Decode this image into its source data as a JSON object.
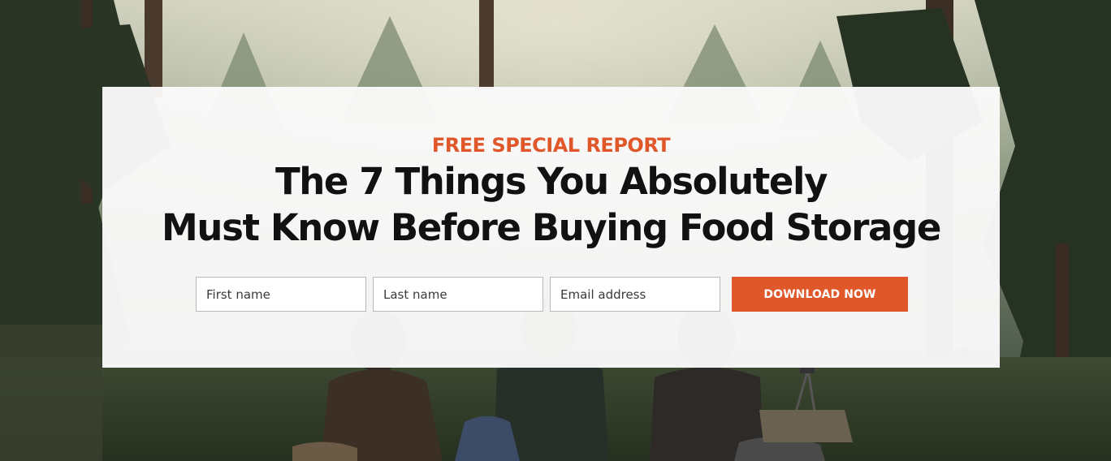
{
  "hero": {
    "eyebrow": "FREE SPECIAL REPORT",
    "headline_line1": "The 7 Things You Absolutely",
    "headline_line2": "Must Know Before Buying Food Storage"
  },
  "form": {
    "first_name_placeholder": "First name",
    "last_name_placeholder": "Last name",
    "email_placeholder": "Email address",
    "submit_label": "DOWNLOAD NOW"
  },
  "colors": {
    "accent": "#e0582a",
    "card_background": "#fafafa",
    "headline_text": "#111111"
  }
}
